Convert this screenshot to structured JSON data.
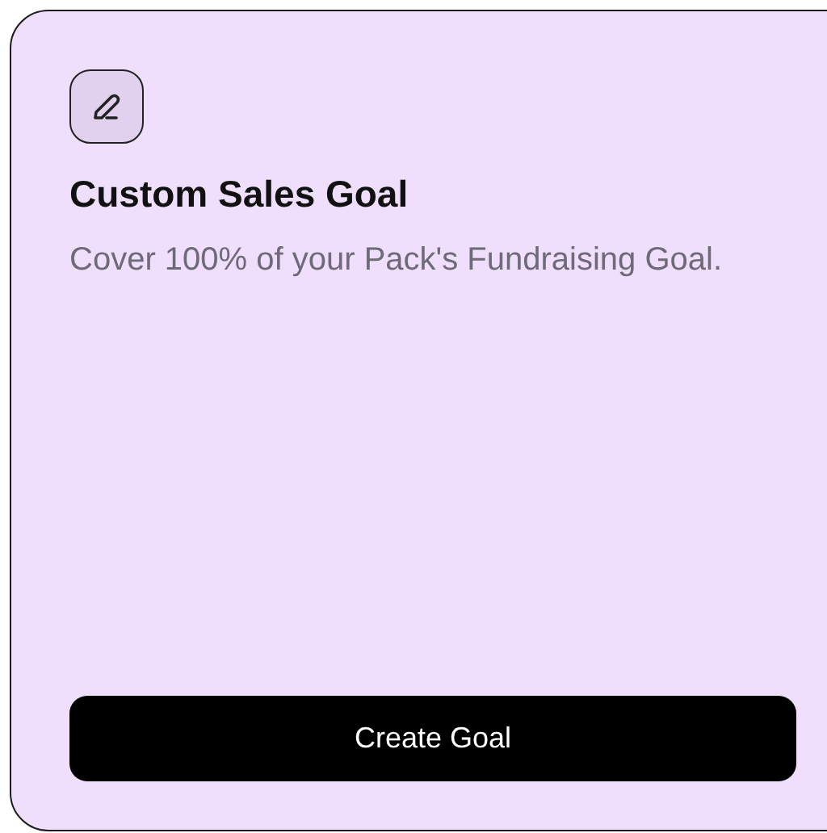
{
  "card": {
    "title": "Custom Sales Goal",
    "description": "Cover 100% of your Pack's Fundraising Goal.",
    "button": "Create Goal"
  }
}
